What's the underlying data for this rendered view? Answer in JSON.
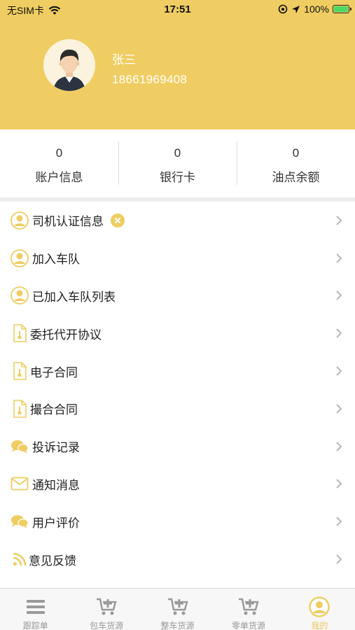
{
  "status_bar": {
    "carrier": "无SIM卡",
    "time": "17:51",
    "battery": "100%"
  },
  "profile": {
    "name": "张三",
    "phone": "18661969408"
  },
  "stats": [
    {
      "value": "0",
      "label": "账户信息"
    },
    {
      "value": "0",
      "label": "银行卡"
    },
    {
      "value": "0",
      "label": "油点余额"
    }
  ],
  "menu": [
    {
      "label": "司机认证信息",
      "icon": "person-icon"
    },
    {
      "label": "加入车队",
      "icon": "person-icon"
    },
    {
      "label": "已加入车队列表",
      "icon": "person-icon"
    },
    {
      "label": "委托代开协议",
      "icon": "document-icon"
    },
    {
      "label": "电子合同",
      "icon": "document-icon"
    },
    {
      "label": "撮合合同",
      "icon": "document-icon"
    },
    {
      "label": "投诉记录",
      "icon": "chat-bubbles-icon"
    },
    {
      "label": "通知消息",
      "icon": "envelope-icon"
    },
    {
      "label": "用户评价",
      "icon": "chat-bubbles-icon"
    },
    {
      "label": "意见反馈",
      "icon": "rss-icon"
    }
  ],
  "tabs": [
    {
      "label": "跟踪单",
      "icon": "list-icon"
    },
    {
      "label": "包车货源",
      "icon": "cart-add-icon"
    },
    {
      "label": "整车货源",
      "icon": "cart-add-icon"
    },
    {
      "label": "零单货源",
      "icon": "cart-add-icon"
    },
    {
      "label": "我的",
      "icon": "profile-icon",
      "active": true
    }
  ],
  "colors": {
    "accent": "#efcd62",
    "tab_inactive": "#999999",
    "tab_active": "#e9c75a"
  }
}
